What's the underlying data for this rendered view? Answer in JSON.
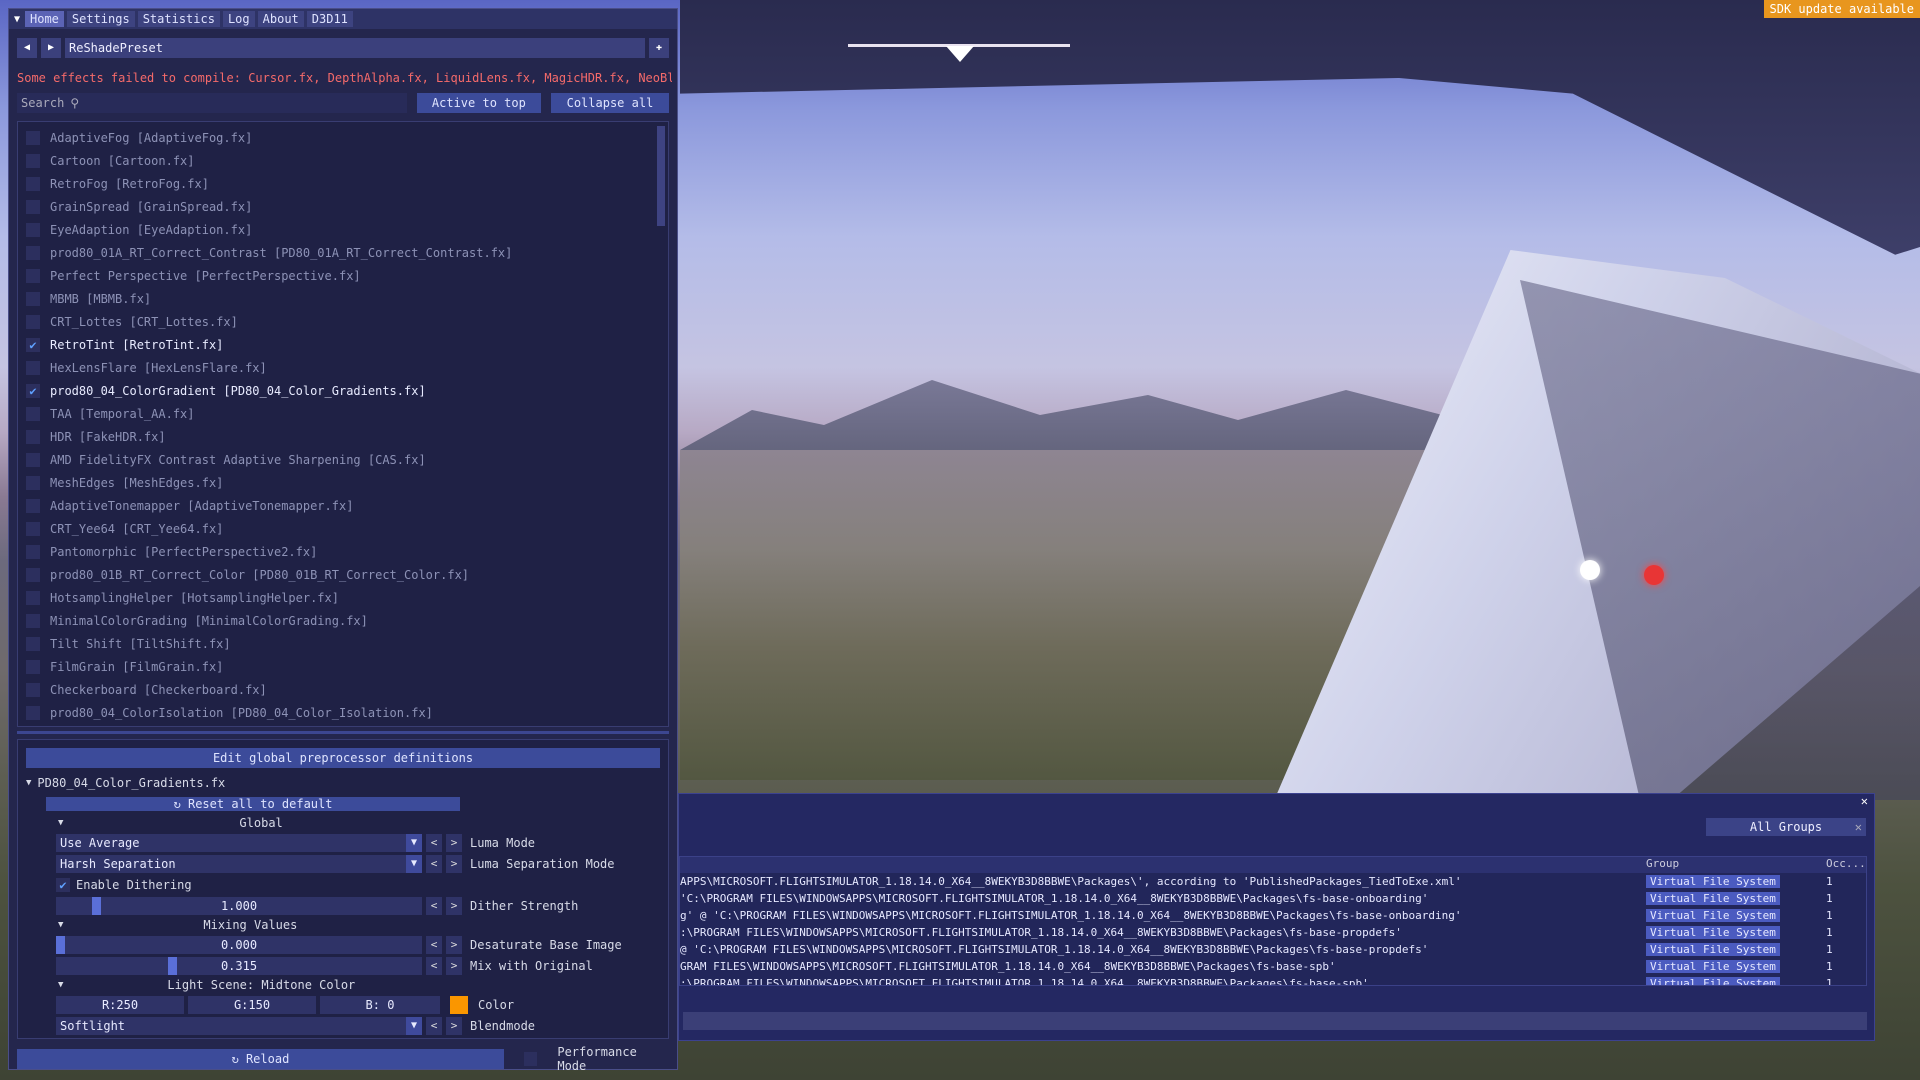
{
  "menu": {
    "tabs": [
      "Home",
      "Settings",
      "Statistics",
      "Log",
      "About",
      "D3D11"
    ],
    "active": 0
  },
  "preset": {
    "name": "ReShadePreset"
  },
  "error_message": "Some effects failed to compile: Cursor.fx, DepthAlpha.fx, LiquidLens.fx, MagicHDR.fx, NeoBloom",
  "search": {
    "placeholder": "Search"
  },
  "buttons": {
    "active_to_top": "Active to top",
    "collapse_all": "Collapse all",
    "edit_preprocessor": "Edit global preprocessor definitions",
    "reset_default": "Reset all to default",
    "reload": "Reload",
    "performance_mode": "Performance Mode"
  },
  "effects": [
    {
      "label": "AdaptiveFog [AdaptiveFog.fx]",
      "enabled": false
    },
    {
      "label": "Cartoon [Cartoon.fx]",
      "enabled": false
    },
    {
      "label": "RetroFog [RetroFog.fx]",
      "enabled": false
    },
    {
      "label": "GrainSpread [GrainSpread.fx]",
      "enabled": false
    },
    {
      "label": "EyeAdaption [EyeAdaption.fx]",
      "enabled": false
    },
    {
      "label": "prod80_01A_RT_Correct_Contrast [PD80_01A_RT_Correct_Contrast.fx]",
      "enabled": false
    },
    {
      "label": "Perfect Perspective [PerfectPerspective.fx]",
      "enabled": false
    },
    {
      "label": "MBMB [MBMB.fx]",
      "enabled": false
    },
    {
      "label": "CRT_Lottes [CRT_Lottes.fx]",
      "enabled": false
    },
    {
      "label": "RetroTint [RetroTint.fx]",
      "enabled": true
    },
    {
      "label": "HexLensFlare [HexLensFlare.fx]",
      "enabled": false
    },
    {
      "label": "prod80_04_ColorGradient [PD80_04_Color_Gradients.fx]",
      "enabled": true
    },
    {
      "label": "TAA [Temporal_AA.fx]",
      "enabled": false
    },
    {
      "label": "HDR [FakeHDR.fx]",
      "enabled": false
    },
    {
      "label": "AMD FidelityFX Contrast Adaptive Sharpening [CAS.fx]",
      "enabled": false
    },
    {
      "label": "MeshEdges [MeshEdges.fx]",
      "enabled": false
    },
    {
      "label": "AdaptiveTonemapper [AdaptiveTonemapper.fx]",
      "enabled": false
    },
    {
      "label": "CRT_Yee64 [CRT_Yee64.fx]",
      "enabled": false
    },
    {
      "label": "Pantomorphic [PerfectPerspective2.fx]",
      "enabled": false
    },
    {
      "label": "prod80_01B_RT_Correct_Color [PD80_01B_RT_Correct_Color.fx]",
      "enabled": false
    },
    {
      "label": "HotsamplingHelper [HotsamplingHelper.fx]",
      "enabled": false
    },
    {
      "label": "MinimalColorGrading [MinimalColorGrading.fx]",
      "enabled": false
    },
    {
      "label": "Tilt Shift [TiltShift.fx]",
      "enabled": false
    },
    {
      "label": "FilmGrain [FilmGrain.fx]",
      "enabled": false
    },
    {
      "label": "Checkerboard [Checkerboard.fx]",
      "enabled": false
    },
    {
      "label": "prod80_04_ColorIsolation [PD80_04_Color_Isolation.fx]",
      "enabled": false
    }
  ],
  "params": {
    "file": "PD80_04_Color_Gradients.fx",
    "global_header": "Global",
    "luma_mode_value": "Use Average",
    "luma_mode_label": "Luma Mode",
    "luma_sep_value": "Harsh Separation",
    "luma_sep_label": "Luma Separation Mode",
    "dithering_label": "Enable Dithering",
    "dither_strength_value": "1.000",
    "dither_strength_label": "Dither Strength",
    "dither_strength_fraction": 0.1,
    "mixing_header": "Mixing Values",
    "desaturate_value": "0.000",
    "desaturate_label": "Desaturate Base Image",
    "desaturate_fraction": 0.0,
    "mix_value": "0.315",
    "mix_label": "Mix with Original",
    "mix_fraction": 0.315,
    "light_scene_header": "Light Scene: Midtone Color",
    "color_r": "R:250",
    "color_g": "G:150",
    "color_b": "B:  0",
    "color_label": "Color",
    "color_swatch": "#fa9600",
    "blendmode_value": "Softlight",
    "blendmode_label": "Blendmode"
  },
  "overlay": {
    "sdk_update": "SDK update available"
  },
  "log": {
    "groups_filter": "All Groups",
    "columns": [
      "Group",
      "Occ..."
    ],
    "rows": [
      {
        "message": "APPS\\MICROSOFT.FLIGHTSIMULATOR_1.18.14.0_X64__8WEKYB3D8BBWE\\Packages\\', according to 'PublishedPackages_TiedToExe.xml'",
        "group": "Virtual File System",
        "occ": "1"
      },
      {
        "message": "'C:\\PROGRAM FILES\\WINDOWSAPPS\\MICROSOFT.FLIGHTSIMULATOR_1.18.14.0_X64__8WEKYB3D8BBWE\\Packages\\fs-base-onboarding'",
        "group": "Virtual File System",
        "occ": "1"
      },
      {
        "message": "g' @ 'C:\\PROGRAM FILES\\WINDOWSAPPS\\MICROSOFT.FLIGHTSIMULATOR_1.18.14.0_X64__8WEKYB3D8BBWE\\Packages\\fs-base-onboarding'",
        "group": "Virtual File System",
        "occ": "1"
      },
      {
        "message": ":\\PROGRAM FILES\\WINDOWSAPPS\\MICROSOFT.FLIGHTSIMULATOR_1.18.14.0_X64__8WEKYB3D8BBWE\\Packages\\fs-base-propdefs'",
        "group": "Virtual File System",
        "occ": "1"
      },
      {
        "message": " @ 'C:\\PROGRAM FILES\\WINDOWSAPPS\\MICROSOFT.FLIGHTSIMULATOR_1.18.14.0_X64__8WEKYB3D8BBWE\\Packages\\fs-base-propdefs'",
        "group": "Virtual File System",
        "occ": "1"
      },
      {
        "message": "GRAM FILES\\WINDOWSAPPS\\MICROSOFT.FLIGHTSIMULATOR_1.18.14.0_X64__8WEKYB3D8BBWE\\Packages\\fs-base-spb'",
        "group": "Virtual File System",
        "occ": "1"
      },
      {
        "message": ":\\PROGRAM FILES\\WINDOWSAPPS\\MICROSOFT.FLIGHTSIMULATOR_1.18.14.0_X64__8WEKYB3D8BBWE\\Packages\\fs-base-spb'",
        "group": "Virtual File System",
        "occ": "1"
      }
    ]
  }
}
